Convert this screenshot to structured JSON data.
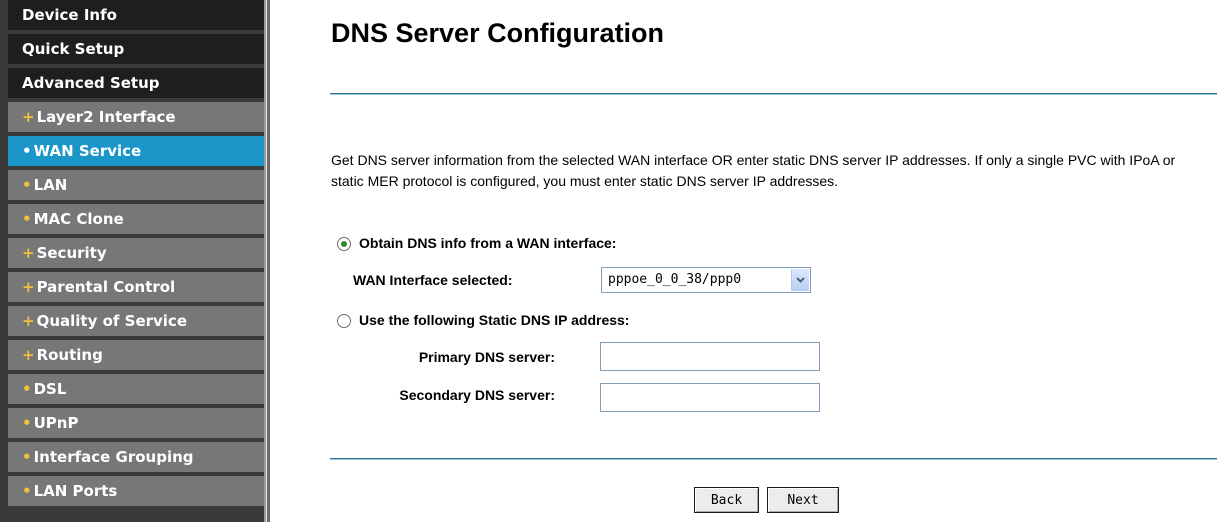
{
  "sidebar": {
    "items": [
      {
        "label": "Device Info",
        "type": "top"
      },
      {
        "label": "Quick Setup",
        "type": "top"
      },
      {
        "label": "Advanced Setup",
        "type": "top"
      },
      {
        "label": "Layer2 Interface",
        "type": "sub",
        "bullet": "+"
      },
      {
        "label": "WAN Service",
        "type": "sub",
        "bullet": "•",
        "active": true
      },
      {
        "label": "LAN",
        "type": "sub",
        "bullet": "•"
      },
      {
        "label": "MAC Clone",
        "type": "sub",
        "bullet": "•"
      },
      {
        "label": "Security",
        "type": "sub",
        "bullet": "+"
      },
      {
        "label": "Parental Control",
        "type": "sub",
        "bullet": "+"
      },
      {
        "label": "Quality of Service",
        "type": "sub",
        "bullet": "+"
      },
      {
        "label": "Routing",
        "type": "sub",
        "bullet": "+"
      },
      {
        "label": "DSL",
        "type": "sub",
        "bullet": "•"
      },
      {
        "label": "UPnP",
        "type": "sub",
        "bullet": "•"
      },
      {
        "label": "Interface Grouping",
        "type": "sub",
        "bullet": "•"
      },
      {
        "label": "LAN Ports",
        "type": "sub",
        "bullet": "•"
      }
    ]
  },
  "main": {
    "title": "DNS Server Configuration",
    "description": "Get DNS server information from the selected WAN interface OR enter static DNS server IP addresses. If only a single PVC with IPoA or static MER protocol is configured, you must enter static DNS server IP addresses.",
    "options": {
      "obtain_label": "Obtain DNS info from a WAN interface:",
      "obtain_selected": true,
      "wan_interface_label": "WAN Interface selected:",
      "wan_interface_value": "pppoe_0_0_38/ppp0",
      "static_label": "Use the following Static DNS IP address:",
      "static_selected": false,
      "primary_label": "Primary DNS server:",
      "primary_value": "",
      "secondary_label": "Secondary DNS server:",
      "secondary_value": ""
    },
    "buttons": {
      "back": "Back",
      "next": "Next"
    }
  },
  "colors": {
    "sidebar_bg": "#3a3a3a",
    "top_item_bg": "#1e1e1e",
    "sub_item_bg": "#777777",
    "active_item_bg": "#1a96c8",
    "bullet": "#f1c03a",
    "rule": "#2a6f96"
  },
  "icons": {
    "select_arrow": "chevron-down-icon",
    "radio_selected": "radio-checked-icon",
    "radio_unselected": "radio-unchecked-icon"
  }
}
